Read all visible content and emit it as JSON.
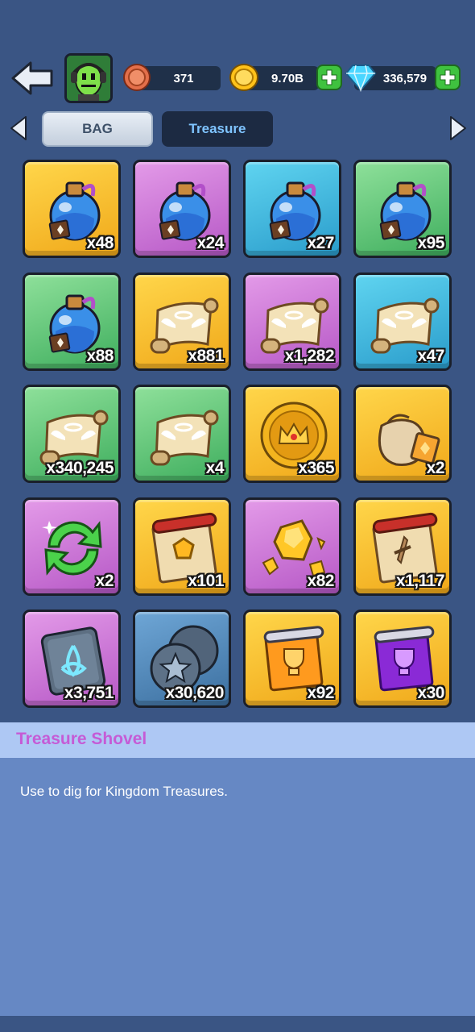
{
  "header": {
    "back_icon": "back-arrow-icon",
    "avatar_icon": "green-alien-avatar-icon",
    "currencies": [
      {
        "icon": "copper-coin-icon",
        "value": "371",
        "has_plus": false
      },
      {
        "icon": "gold-coin-icon",
        "value": "9.70B",
        "has_plus": true
      },
      {
        "icon": "diamond-icon",
        "value": "336,579",
        "has_plus": true
      }
    ]
  },
  "tabs": {
    "bag_label": "BAG",
    "treasure_label": "Treasure",
    "selected": "Treasure"
  },
  "items": [
    {
      "icon": "blue-potion-icon",
      "bg": "yellow",
      "count": "x48"
    },
    {
      "icon": "blue-potion-icon",
      "bg": "purple",
      "count": "x24"
    },
    {
      "icon": "blue-potion-icon",
      "bg": "blue",
      "count": "x27"
    },
    {
      "icon": "blue-potion-icon",
      "bg": "green",
      "count": "x95"
    },
    {
      "icon": "blue-potion-icon",
      "bg": "green",
      "count": "x88"
    },
    {
      "icon": "winged-scroll-icon",
      "bg": "yellow",
      "count": "x881"
    },
    {
      "icon": "winged-scroll-icon",
      "bg": "purple",
      "count": "x1,282"
    },
    {
      "icon": "winged-scroll-icon",
      "bg": "blue",
      "count": "x47"
    },
    {
      "icon": "winged-scroll-icon",
      "bg": "green",
      "count": "x340,245"
    },
    {
      "icon": "winged-scroll-icon",
      "bg": "green",
      "count": "x4"
    },
    {
      "icon": "crown-coin-icon",
      "bg": "yellow",
      "count": "x365"
    },
    {
      "icon": "loot-sack-icon",
      "bg": "yellow",
      "count": "x2"
    },
    {
      "icon": "refresh-arrows-icon",
      "bg": "purple",
      "count": "x2"
    },
    {
      "icon": "gem-map-scroll-icon",
      "bg": "yellow",
      "count": "x101"
    },
    {
      "icon": "gold-ore-icon",
      "bg": "purple",
      "count": "x82"
    },
    {
      "icon": "sword-map-scroll-icon",
      "bg": "yellow",
      "count": "x1,117"
    },
    {
      "icon": "rune-stone-icon",
      "bg": "purple",
      "count": "x3,751"
    },
    {
      "icon": "star-stones-icon",
      "bg": "steel",
      "count": "x30,620"
    },
    {
      "icon": "orange-trophy-banner-icon",
      "bg": "yellow",
      "count": "x92"
    },
    {
      "icon": "purple-trophy-banner-icon",
      "bg": "yellow",
      "count": "x30"
    }
  ],
  "detail": {
    "title": "Treasure Shovel",
    "description": "Use to dig for Kingdom Treasures."
  },
  "colors": {
    "background": "#3a5584",
    "tile_yellow": "#f0a81a",
    "tile_purple": "#b658c6",
    "tile_blue": "#2a9ccb",
    "tile_green": "#3fae5e",
    "tile_steel": "#3c6f9f",
    "detail_title": "#c55bd6",
    "detail_panel": "#6688c4",
    "detail_header": "#aec8f4"
  }
}
